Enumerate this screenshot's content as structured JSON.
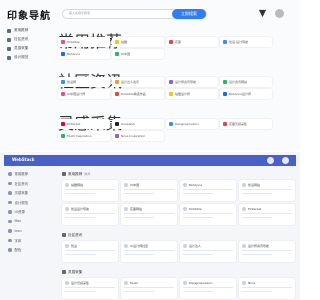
{
  "top": {
    "logo": "印象导航",
    "search": {
      "placeholder": "输入关键字搜索",
      "button": "立即搜索"
    },
    "sidebar": [
      "常用推荐",
      "社区资讯",
      "灵感采集",
      "设计规范"
    ],
    "categories": [
      {
        "title": "常用推荐",
        "items": [
          {
            "label": "Dribbble",
            "color": "#ea4c89"
          },
          {
            "label": "站酷",
            "color": "#f5c518"
          },
          {
            "label": "花瓣",
            "color": "#e0484e"
          },
          {
            "label": "优设-设计导航",
            "color": "#3f8cf3"
          },
          {
            "label": "Behance",
            "color": "#1769ff"
          },
          {
            "label": "UI中国",
            "color": "#2fb36b"
          }
        ]
      },
      {
        "title": "社区资讯",
        "items": [
          {
            "label": "优设网",
            "color": "#3f8cf3"
          },
          {
            "label": "设计达人资讯",
            "color": "#f0a020"
          },
          {
            "label": "设计师资讯导航",
            "color": "#8e60d9"
          },
          {
            "label": "设计资讯网站",
            "color": "#2fb36b"
          },
          {
            "label": "UI中国设计师",
            "color": "#ea4c89"
          },
          {
            "label": "Dribbble精选作品",
            "color": "#e0484e"
          },
          {
            "label": "站酷设计师",
            "color": "#f5c518"
          },
          {
            "label": "Behance设计师",
            "color": "#1769ff"
          }
        ]
      },
      {
        "title": "灵感采集",
        "items": [
          {
            "label": "Pinterest",
            "color": "#e60023"
          },
          {
            "label": "Unsplash",
            "color": "#222222"
          },
          {
            "label": "Designspiration",
            "color": "#3f8cf3"
          },
          {
            "label": "花瓣灵感采集",
            "color": "#e0484e"
          },
          {
            "label": "Muzli Inspiration",
            "color": "#2fb36b"
          },
          {
            "label": "Niice Inspiration",
            "color": "#8e60d9"
          }
        ]
      }
    ]
  },
  "bottom": {
    "brand": "WebStack",
    "sidebar": [
      "常用推荐",
      "社区资讯",
      "灵感采集",
      "设计规范",
      "UI资源",
      "Mac",
      "Icon",
      "字体",
      "配色"
    ],
    "categories": [
      {
        "title": "常用推荐",
        "subtitle": "推荐",
        "cards": [
          "站酷网站",
          "UI中国",
          "Behance",
          "优设网站",
          "优设设计导航",
          "花瓣网站",
          "Dribbble",
          "Pinterest"
        ]
      },
      {
        "title": "社区资讯",
        "subtitle": "",
        "cards": [
          "优设",
          "UI设计师社区",
          "设计达人",
          "设计师资讯导航"
        ]
      },
      {
        "title": "灵感采集",
        "subtitle": "",
        "cards": [
          "设计灵感采集",
          "Muzli",
          "Designspiration",
          "Niice"
        ]
      }
    ]
  }
}
